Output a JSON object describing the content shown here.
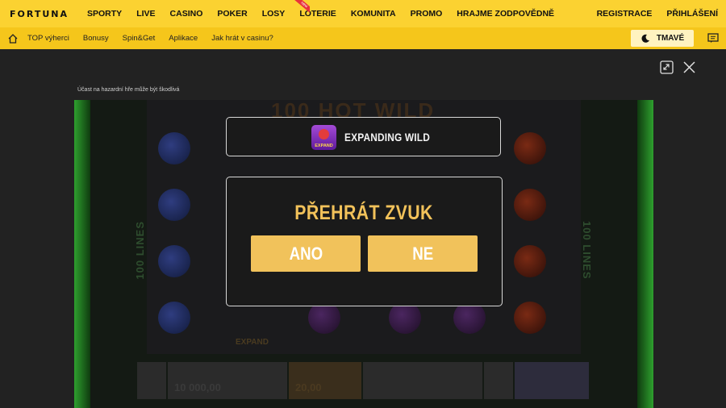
{
  "brand": {
    "logo": "FORTUNA"
  },
  "top_nav": {
    "items": [
      "SPORTY",
      "LIVE",
      "CASINO",
      "POKER",
      "LOSY",
      "LOTERIE",
      "KOMUNITA",
      "PROMO",
      "HRAJME ZODPOVĚDNĚ"
    ],
    "new_badge": "new",
    "register": "REGISTRACE",
    "login": "PŘIHLÁŠENÍ"
  },
  "sub_nav": {
    "items": [
      "TOP výherci",
      "Bonusy",
      "Spin&Get",
      "Aplikace",
      "Jak hrát v casinu?"
    ],
    "theme_label": "TMAVÉ"
  },
  "game": {
    "warning": "Účast na hazardní hře může být škodlivá",
    "title": "100 HOT WILD",
    "side_lines": "100 LINES",
    "expand_symbol_label": "EXPAND",
    "bet_value": "10 000,00",
    "win_value": "20,00",
    "feature_box": {
      "icon_label": "EXPAND",
      "text": "EXPANDING WILD"
    },
    "sound_dialog": {
      "title": "PŘEHRÁT ZVUK",
      "yes": "ANO",
      "no": "NE"
    }
  },
  "icons": [
    "home-icon",
    "moon-icon",
    "chat-icon",
    "fullscreen-icon",
    "close-icon"
  ],
  "colors": {
    "brand_yellow": "#fbd231",
    "sub_yellow": "#f5c61b",
    "gold": "#f1c25b"
  }
}
